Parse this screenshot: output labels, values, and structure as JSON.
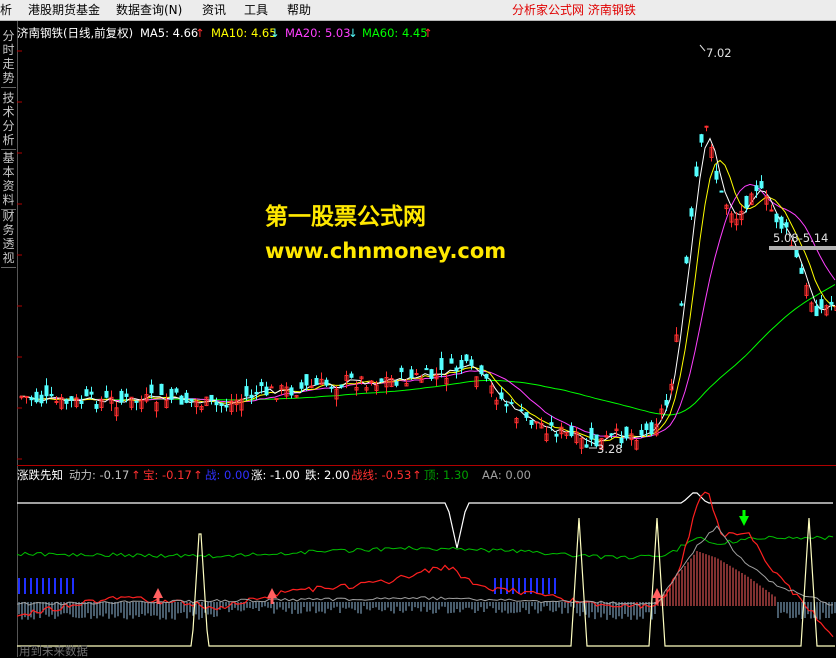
{
  "menubar": {
    "items": [
      "析",
      "港股期货基金",
      "数据查询(N)",
      "资讯",
      "工具",
      "帮助"
    ],
    "title": "分析家公式网  济南钢铁"
  },
  "sidebar": {
    "tabs": [
      "分时走势",
      "技术分析",
      "基本资料",
      "财务透视"
    ]
  },
  "main_chart": {
    "legend": {
      "name": "济南钢铁(日线,前复权)",
      "ma5": "MA5: 4.66",
      "ma10": "MA10: 4.65",
      "ma20": "MA20: 5.03",
      "ma60": "MA60: 4.45"
    },
    "labels": {
      "high": "7.02",
      "low": "3.28",
      "band": "5.08-5.14"
    },
    "watermark": {
      "line1": "第一股票公式网",
      "line2": "www.chnmoney.com"
    },
    "colors": {
      "up": "#ff3030",
      "down": "#54ffff",
      "ma5": "#ffffff",
      "ma10": "#ffff00",
      "ma20": "#ff40ff",
      "ma60": "#00ff00"
    }
  },
  "sub_chart": {
    "legend": {
      "name": "涨跌先知",
      "dongli": "动力: -0.17",
      "bao": "宝: -0.17",
      "zhan": "战: 0.00",
      "zhang": "涨: -1.00",
      "die": "跌: 2.00",
      "zhanxian": "战线: -0.53",
      "ding": "顶: 1.30",
      "aa": "AA: 0.00"
    },
    "footer": "用到未来数据"
  }
}
